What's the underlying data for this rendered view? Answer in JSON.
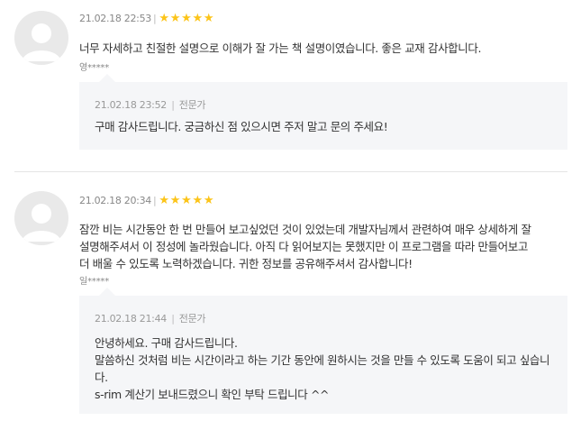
{
  "reviews": [
    {
      "date": "21.02.18 22:53",
      "separator": "|",
      "rating": 5,
      "text": "너무 자세하고 친절한 설명으로 이해가 잘 가는 책 설명이였습니다. 좋은 교재 감사합니다.",
      "author": "영*****",
      "reply": {
        "date": "21.02.18 23:52",
        "separator": "|",
        "role": "전문가",
        "text": "구매 감사드립니다. 궁금하신 점 있으시면 주저 말고 문의 주세요!"
      }
    },
    {
      "date": "21.02.18 20:34",
      "separator": "|",
      "rating": 5,
      "text": "잠깐 비는 시간동안 한 번 만들어 보고싶었던 것이 있었는데 개발자님께서 관련하여 매우 상세하게 잘\n설명해주셔서 이 정성에 놀라웠습니다. 아직 다 읽어보지는 못했지만 이 프로그램을 따라 만들어보고\n더 배울 수 있도록 노력하겠습니다. 귀한 정보를 공유해주셔서 감사합니다!",
      "author": "일*****",
      "reply": {
        "date": "21.02.18 21:44",
        "separator": "|",
        "role": "전문가",
        "text": "안녕하세요. 구매 감사드립니다.\n말씀하신 것처럼 비는 시간이라고 하는 기간 동안에 원하시는 것을 만들 수 있도록 도움이 되고 싶습니\n다.\ns-rim 계산기 보내드렸으니 확인 부탁 드립니다 ^^"
      }
    }
  ],
  "star_icon": "star-icon",
  "colors": {
    "star": "#fcc419",
    "reply_bg": "#f5f6f8",
    "divider": "#e5e5e5"
  }
}
